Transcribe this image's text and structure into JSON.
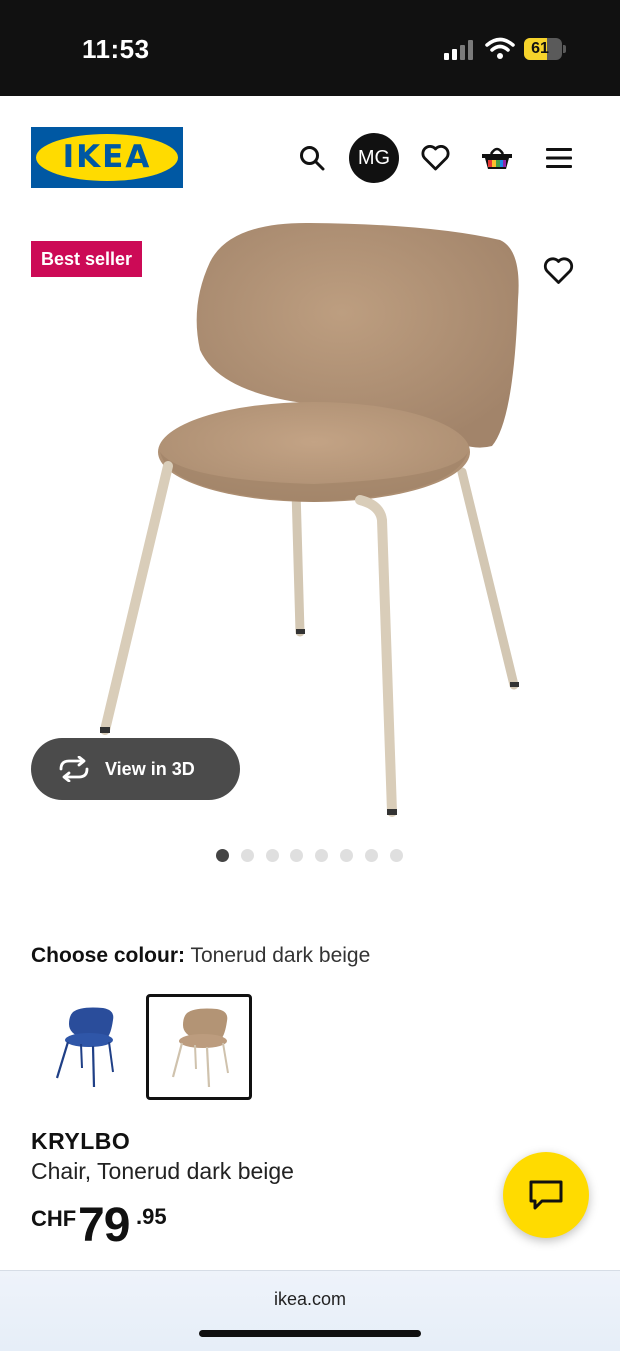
{
  "status_bar": {
    "time": "11:53",
    "battery_percent": "61",
    "battery_level": 0.61,
    "signal_icon": "signal-bars-icon",
    "wifi_icon": "wifi-icon"
  },
  "header": {
    "logo_text": "IKEA",
    "avatar_initials": "MG",
    "icons": [
      "search-icon",
      "heart-icon",
      "shopping-bag-icon",
      "menu-icon"
    ]
  },
  "product_image": {
    "badge": "Best seller",
    "view_3d_label": "View in 3D",
    "carousel_count": 8,
    "carousel_active_index": 0
  },
  "colour": {
    "label": "Choose colour:",
    "selected_value": "Tonerud dark beige",
    "swatches": [
      {
        "name": "blue",
        "selected": false,
        "color": "#2a4d9b"
      },
      {
        "name": "Tonerud dark beige",
        "selected": true,
        "color": "#b39475"
      }
    ]
  },
  "product": {
    "name": "KRYLBO",
    "description": "Chair, Tonerud dark beige",
    "price_currency": "CHF",
    "price_integer": "79",
    "price_decimal": ".95"
  },
  "browser": {
    "url": "ikea.com"
  },
  "colors": {
    "ikea_blue": "#0058a3",
    "ikea_yellow": "#ffdb00",
    "badge_red": "#cc0a56",
    "chair_fabric": "#b39475",
    "chair_legs": "#d6cbb8"
  }
}
